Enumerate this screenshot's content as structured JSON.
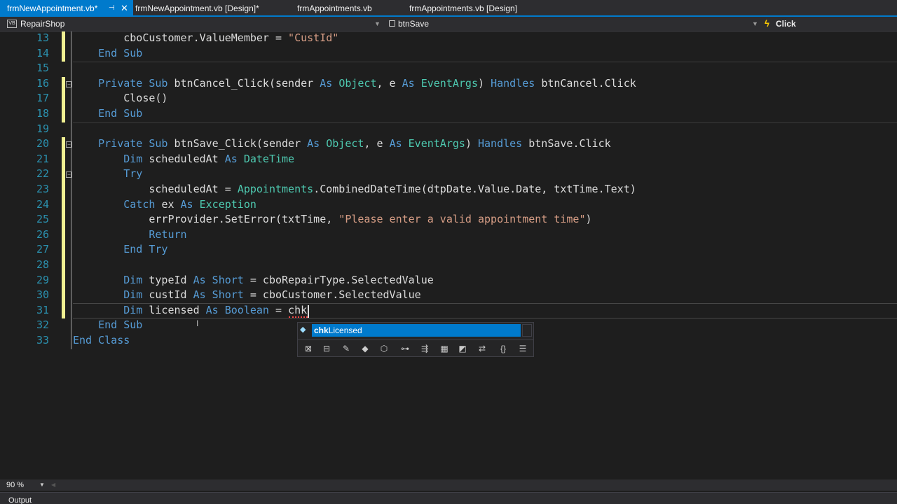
{
  "tabs": [
    {
      "label": "frmNewAppointment.vb*",
      "active": true
    },
    {
      "label": "frmNewAppointment.vb [Design]*",
      "active": false
    },
    {
      "label": "frmAppointments.vb",
      "active": false
    },
    {
      "label": "frmAppointments.vb [Design]",
      "active": false
    }
  ],
  "navbar": {
    "project": "RepairShop",
    "object": "btnSave",
    "event": "Click"
  },
  "editor": {
    "lines": [
      {
        "n": "13",
        "tokens": [
          [
            "",
            "        cboCustomer.ValueMember = "
          ],
          [
            "s",
            "\"CustId\""
          ]
        ]
      },
      {
        "n": "14",
        "tokens": [
          [
            "k",
            "    End Sub"
          ]
        ]
      },
      {
        "n": "15",
        "tokens": []
      },
      {
        "n": "16",
        "tokens": [
          [
            "k",
            "    Private Sub "
          ],
          [
            "",
            "btnCancel_Click(sender "
          ],
          [
            "k",
            "As "
          ],
          [
            "t",
            "Object"
          ],
          [
            "",
            ", e "
          ],
          [
            "k",
            "As "
          ],
          [
            "t",
            "EventArgs"
          ],
          [
            "",
            ") "
          ],
          [
            "k",
            "Handles "
          ],
          [
            "",
            "btnCancel.Click"
          ]
        ]
      },
      {
        "n": "17",
        "tokens": [
          [
            "",
            "        Close()"
          ]
        ]
      },
      {
        "n": "18",
        "tokens": [
          [
            "k",
            "    End Sub"
          ]
        ]
      },
      {
        "n": "19",
        "tokens": []
      },
      {
        "n": "20",
        "tokens": [
          [
            "k",
            "    Private Sub "
          ],
          [
            "",
            "btnSave_Click(sender "
          ],
          [
            "k",
            "As "
          ],
          [
            "t",
            "Object"
          ],
          [
            "",
            ", e "
          ],
          [
            "k",
            "As "
          ],
          [
            "t",
            "EventArgs"
          ],
          [
            "",
            ") "
          ],
          [
            "k",
            "Handles "
          ],
          [
            "",
            "btnSave.Click"
          ]
        ]
      },
      {
        "n": "21",
        "tokens": [
          [
            "k",
            "        Dim "
          ],
          [
            "",
            "scheduledAt "
          ],
          [
            "k",
            "As "
          ],
          [
            "t",
            "DateTime"
          ]
        ]
      },
      {
        "n": "22",
        "tokens": [
          [
            "k",
            "        Try"
          ]
        ]
      },
      {
        "n": "23",
        "tokens": [
          [
            "",
            "            scheduledAt = "
          ],
          [
            "t",
            "Appointments"
          ],
          [
            "",
            ".CombinedDateTime(dtpDate.Value.Date, txtTime.Text)"
          ]
        ]
      },
      {
        "n": "24",
        "tokens": [
          [
            "k",
            "        Catch "
          ],
          [
            "",
            "ex "
          ],
          [
            "k",
            "As "
          ],
          [
            "t",
            "Exception"
          ]
        ]
      },
      {
        "n": "25",
        "tokens": [
          [
            "",
            "            errProvider.SetError(txtTime, "
          ],
          [
            "s",
            "\"Please enter a valid appointment time\""
          ],
          [
            "",
            ")"
          ]
        ]
      },
      {
        "n": "26",
        "tokens": [
          [
            "k",
            "            Return"
          ]
        ]
      },
      {
        "n": "27",
        "tokens": [
          [
            "k",
            "        End Try"
          ]
        ]
      },
      {
        "n": "28",
        "tokens": []
      },
      {
        "n": "29",
        "tokens": [
          [
            "k",
            "        Dim "
          ],
          [
            "",
            "typeId "
          ],
          [
            "k",
            "As Short "
          ],
          [
            "",
            "= cboRepairType.SelectedValue"
          ]
        ]
      },
      {
        "n": "30",
        "tokens": [
          [
            "k",
            "        Dim "
          ],
          [
            "",
            "custId "
          ],
          [
            "k",
            "As Short "
          ],
          [
            "",
            "= cboCustomer.SelectedValue"
          ]
        ]
      },
      {
        "n": "31",
        "tokens": [
          [
            "k",
            "        Dim "
          ],
          [
            "",
            "licensed "
          ],
          [
            "k",
            "As Boolean "
          ],
          [
            "",
            "= chk"
          ]
        ]
      },
      {
        "n": "32",
        "tokens": [
          [
            "k",
            "    End Sub"
          ]
        ]
      },
      {
        "n": "33",
        "tokens": [
          [
            "k",
            "End Class"
          ]
        ]
      }
    ]
  },
  "intellisense": {
    "match": "chk",
    "rest": "Licensed",
    "filters": [
      "properties-filter",
      "list-filter",
      "settings-filter",
      "class-filter",
      "module-filter",
      "method-filter",
      "extension-filter",
      "structure-filter",
      "enum-filter",
      "interface-filter",
      "namespace-filter",
      "snippet-filter"
    ]
  },
  "status": {
    "zoom": "90 %",
    "output_label": "Output"
  },
  "colors": {
    "accent": "#007acc",
    "keyword": "#569cd6",
    "type": "#4ec9b0",
    "string": "#d69d85",
    "line_number": "#2b91af"
  }
}
